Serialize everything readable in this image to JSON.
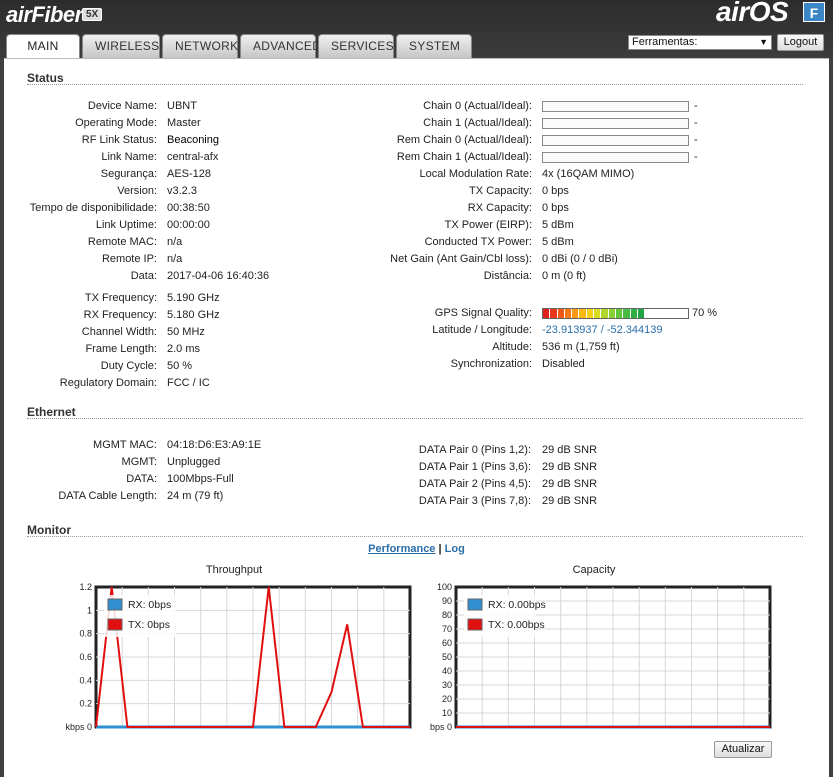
{
  "header": {
    "brand": "airFiber",
    "brand_badge": "5X",
    "os_name": "airOS",
    "os_badge": "F",
    "tools_select": {
      "value": "Ferramentas:"
    },
    "logout_label": "Logout"
  },
  "tabs": [
    {
      "label": "MAIN",
      "active": true
    },
    {
      "label": "WIRELESS"
    },
    {
      "label": "NETWORK"
    },
    {
      "label": "ADVANCED"
    },
    {
      "label": "SERVICES"
    },
    {
      "label": "SYSTEM"
    }
  ],
  "status": {
    "title": "Status",
    "left": [
      {
        "label": "Device Name:",
        "value": "UBNT"
      },
      {
        "label": "Operating Mode:",
        "value": "Master"
      },
      {
        "label": "RF Link Status:",
        "value": "Beaconing"
      },
      {
        "label": "Link Name:",
        "value": "central-afx"
      },
      {
        "label": "Segurança:",
        "value": "AES-128"
      },
      {
        "label": "Version:",
        "value": "v3.2.3"
      },
      {
        "label": "Tempo de disponibilidade:",
        "value": "00:38:50"
      },
      {
        "label": "Link Uptime:",
        "value": "00:00:00"
      },
      {
        "label": "Remote MAC:",
        "value": "n/a"
      },
      {
        "label": "Remote IP:",
        "value": "n/a"
      },
      {
        "label": "Data:",
        "value": "2017-04-06 16:40:36"
      }
    ],
    "left2": [
      {
        "label": "TX Frequency:",
        "value": "5.190 GHz"
      },
      {
        "label": "RX Frequency:",
        "value": "5.180 GHz"
      },
      {
        "label": "Channel Width:",
        "value": "50 MHz"
      },
      {
        "label": "Frame Length:",
        "value": "2.0 ms"
      },
      {
        "label": "Duty Cycle:",
        "value": "50 %"
      },
      {
        "label": "Regulatory Domain:",
        "value": "FCC / IC"
      }
    ],
    "chains": [
      {
        "label": "Chain 0 (Actual/Ideal):",
        "value": "-"
      },
      {
        "label": "Chain 1 (Actual/Ideal):",
        "value": "-"
      },
      {
        "label": "Rem Chain 0 (Actual/Ideal):",
        "value": "-"
      },
      {
        "label": "Rem Chain 1 (Actual/Ideal):",
        "value": "-"
      }
    ],
    "right": [
      {
        "label": "Local Modulation Rate:",
        "value": "4x (16QAM MIMO)"
      },
      {
        "label": "TX Capacity:",
        "value": "0 bps"
      },
      {
        "label": "RX Capacity:",
        "value": "0 bps"
      },
      {
        "label": "TX Power (EIRP):",
        "value": "5 dBm"
      },
      {
        "label": "Conducted TX Power:",
        "value": "5 dBm"
      },
      {
        "label": "Net Gain (Ant Gain/Cbl loss):",
        "value": "0 dBi (0 / 0 dBi)"
      },
      {
        "label": "Distância:",
        "value": "0 m (0 ft)"
      }
    ],
    "gps": {
      "label": "GPS Signal Quality:",
      "value": "70 %",
      "percent": 70,
      "colors": [
        "#e02020",
        "#e83a1a",
        "#ef5a18",
        "#f57a16",
        "#f99a14",
        "#fbb814",
        "#f5d21a",
        "#d8dc22",
        "#b0d82c",
        "#88d034",
        "#62c63c",
        "#46bc40",
        "#30b044",
        "#22a444"
      ]
    },
    "right2": [
      {
        "label": "Latitude / Longitude:",
        "value": "-23.913937 / -52.344139",
        "link": true
      },
      {
        "label": "Altitude:",
        "value": "536 m (1,759 ft)"
      },
      {
        "label": "Synchronization:",
        "value": "Disabled"
      }
    ]
  },
  "ethernet": {
    "title": "Ethernet",
    "left": [
      {
        "label": "MGMT MAC:",
        "value": "04:18:D6:E3:A9:1E"
      },
      {
        "label": "MGMT:",
        "value": "Unplugged"
      },
      {
        "label": "DATA:",
        "value": "100Mbps-Full"
      },
      {
        "label": "DATA Cable Length:",
        "value": "24 m (79 ft)"
      }
    ],
    "right": [
      {
        "label": "DATA Pair 0 (Pins 1,2):",
        "value": "29 dB SNR"
      },
      {
        "label": "DATA Pair 1 (Pins 3,6):",
        "value": "29 dB SNR"
      },
      {
        "label": "DATA Pair 2 (Pins 4,5):",
        "value": "29 dB SNR"
      },
      {
        "label": "DATA Pair 3 (Pins 7,8):",
        "value": "29 dB SNR"
      }
    ]
  },
  "monitor": {
    "title": "Monitor",
    "performance_label": "Performance",
    "separator": "|",
    "log_label": "Log",
    "refresh_label": "Atualizar"
  },
  "chart_data": [
    {
      "type": "line",
      "title": "Throughput",
      "ylabel": "kbps",
      "ylim": [
        0,
        1.2
      ],
      "yticks": [
        "0",
        "0.2",
        "0.4",
        "0.6",
        "0.8",
        "1",
        "1.2"
      ],
      "grid": true,
      "legend": "top-left",
      "series": [
        {
          "name": "RX: 0bps",
          "color": "#2f8fd0",
          "values": [
            0,
            0,
            0,
            0,
            0,
            0,
            0,
            0,
            0,
            0,
            0,
            0,
            0,
            0,
            0,
            0,
            0,
            0,
            0,
            0,
            0
          ]
        },
        {
          "name": "TX: 0bps",
          "color": "#e01010",
          "values": [
            0,
            1.2,
            0,
            0,
            0,
            0,
            0,
            0,
            0,
            0,
            0,
            1.2,
            0,
            0,
            0,
            0.3,
            0.88,
            0,
            0,
            0,
            0
          ]
        }
      ]
    },
    {
      "type": "line",
      "title": "Capacity",
      "ylabel": "bps",
      "ylim": [
        0,
        100
      ],
      "yticks": [
        "0",
        "10",
        "20",
        "30",
        "40",
        "50",
        "60",
        "70",
        "80",
        "90",
        "100"
      ],
      "grid": true,
      "legend": "top-left",
      "series": [
        {
          "name": "RX: 0.00bps",
          "color": "#2f8fd0",
          "values": [
            0,
            0,
            0,
            0,
            0,
            0,
            0,
            0,
            0,
            0,
            0
          ]
        },
        {
          "name": "TX: 0.00bps",
          "color": "#e01010",
          "values": [
            0,
            0,
            0,
            0,
            0,
            0,
            0,
            0,
            0,
            0,
            0
          ]
        }
      ]
    }
  ]
}
